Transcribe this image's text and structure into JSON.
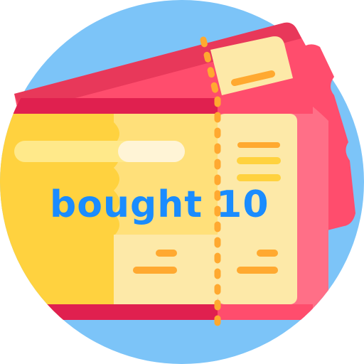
{
  "caption": {
    "text": "bought 10",
    "color": "#1a8cff"
  },
  "icon": {
    "name": "tickets-icon",
    "colors": {
      "circle": "#7cc4f8",
      "back_ticket": "#ff4d6d",
      "back_ticket_dark": "#e8385a",
      "front_ticket_left": "#ffd23f",
      "front_ticket_band": "#e0204f",
      "front_ticket_right": "#ff6f87",
      "stub": "#fde9a8",
      "perforation": "#ffa930",
      "stub_lines": "#ffd23f"
    }
  }
}
